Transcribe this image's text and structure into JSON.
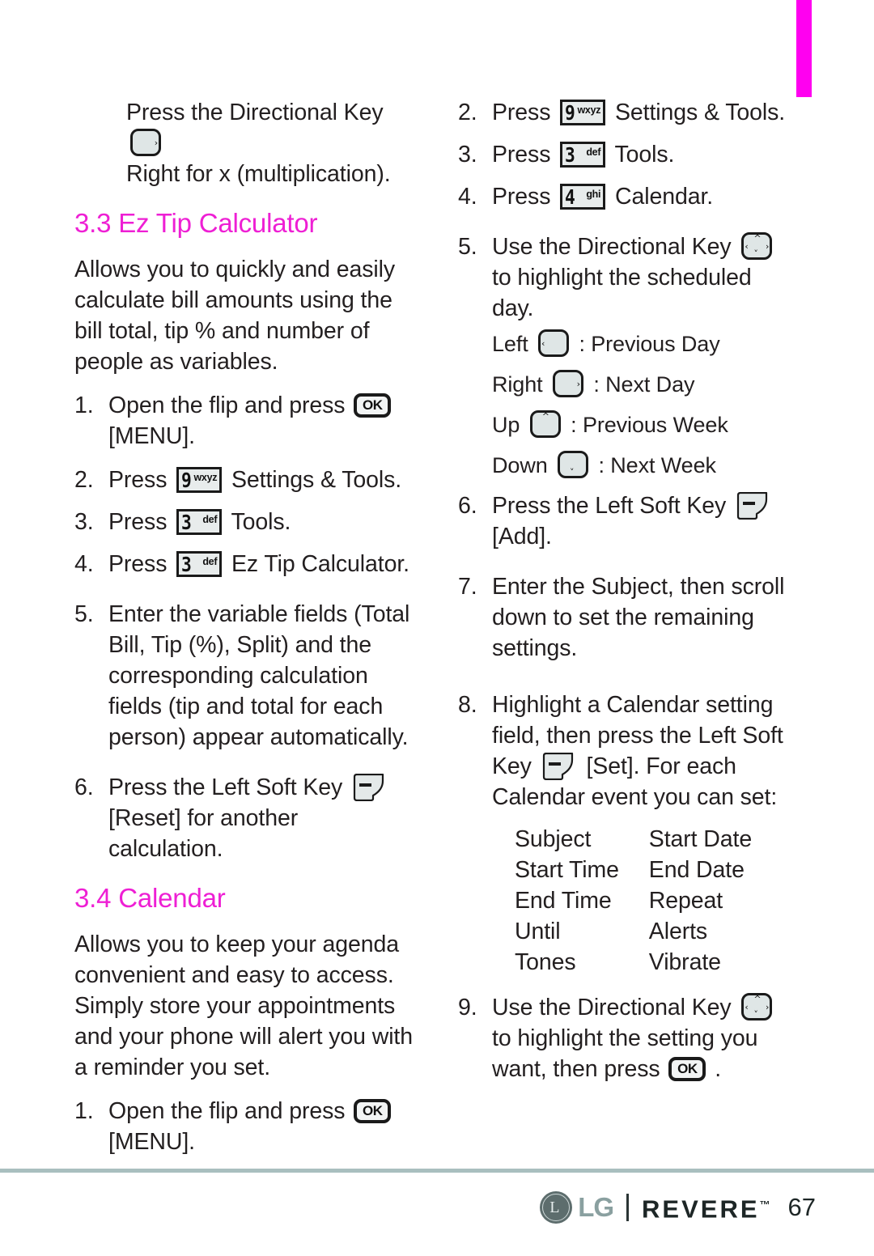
{
  "page": {
    "number": "67",
    "tab_color": "#ff00f0",
    "heading_color": "#ee1fd4",
    "rule_color": "#a9bfbf"
  },
  "footer": {
    "lg_text": "LG",
    "product_text": "REVERE",
    "trademark": "™",
    "page_number": "67"
  },
  "left_column": {
    "continued_note": {
      "line1_pre": "Press the Directional Key",
      "line1_key": "directional-key-right",
      "line2": "Right for x (multiplication)."
    },
    "section_ez_tip": {
      "heading": "3.3 Ez Tip Calculator",
      "intro": "Allows you to quickly and easily calculate bill amounts using the bill total, tip % and number of people as variables.",
      "steps": [
        {
          "num": "1.",
          "pre": "Open the flip and press",
          "key": "ok-key",
          "post": "[MENU]."
        },
        {
          "num": "2.",
          "pre": "Press",
          "key": {
            "digit": "9",
            "letters": "wxyz"
          },
          "post": "Settings & Tools."
        },
        {
          "num": "3.",
          "pre": "Press",
          "key": {
            "digit": "3",
            "letters": "def"
          },
          "post": "Tools."
        },
        {
          "num": "4.",
          "pre": "Press",
          "key": {
            "digit": "3",
            "letters": "def"
          },
          "post": "Ez Tip Calculator."
        },
        {
          "num": "5.",
          "pre": "Enter the variable fields (Total Bill, Tip (%), Split) and the corresponding calculation fields (tip and total for each person) appear automatically.",
          "key": null,
          "post": ""
        },
        {
          "num": "6.",
          "pre": "Press the Left Soft Key",
          "key": "left-soft-key",
          "post": "[Reset] for another calculation."
        }
      ]
    },
    "section_calendar": {
      "heading": "3.4 Calendar",
      "intro": "Allows you to keep your agenda convenient and easy to access. Simply store your appointments and your phone will alert you with a reminder you set.",
      "steps": [
        {
          "num": "1.",
          "pre": "Open the flip and press",
          "key": "ok-key",
          "post": "[MENU]."
        }
      ]
    }
  },
  "right_column": {
    "steps": [
      {
        "num": "2.",
        "pre": "Press",
        "key": {
          "digit": "9",
          "letters": "wxyz"
        },
        "post": "Settings & Tools."
      },
      {
        "num": "3.",
        "pre": "Press",
        "key": {
          "digit": "3",
          "letters": "def"
        },
        "post": "Tools."
      },
      {
        "num": "4.",
        "pre": "Press",
        "key": {
          "digit": "4",
          "letters": "ghi"
        },
        "post": "Calendar."
      },
      {
        "num": "5.",
        "pre": "Use the Directional Key",
        "key": "directional-key-all",
        "post": "to highlight  the scheduled day."
      },
      {
        "num": "6.",
        "pre": "Press the Left Soft Key",
        "key": "left-soft-key",
        "post": "[Add]."
      },
      {
        "num": "7.",
        "pre": "Enter the Subject, then scroll down to set the remaining settings.",
        "key": null,
        "post": ""
      },
      {
        "num": "8.",
        "pre": "Highlight a Calendar setting field, then press the Left Soft Key",
        "key": "left-soft-key",
        "post": "[Set]. For each Calendar event you can set:"
      },
      {
        "num": "9.",
        "pre": "Use the Directional Key",
        "key": "directional-key-all",
        "post": "to highlight the setting you want, then press",
        "key2": "ok-key",
        "post2": "."
      }
    ],
    "direction_list": [
      {
        "label": "Left",
        "key": "directional-key-left",
        "desc": ": Previous Day"
      },
      {
        "label": "Right",
        "key": "directional-key-right",
        "desc": ": Next Day"
      },
      {
        "label": "Up",
        "key": "directional-key-up",
        "desc": ": Previous Week"
      },
      {
        "label": "Down",
        "key": "directional-key-down",
        "desc": ": Next Week"
      }
    ],
    "settings_table": {
      "rows": [
        {
          "c1": "Subject",
          "c2": "Start Date"
        },
        {
          "c1": "Start Time",
          "c2": "End Date"
        },
        {
          "c1": "End Time",
          "c2": "Repeat"
        },
        {
          "c1": "Until",
          "c2": "Alerts"
        },
        {
          "c1": "Tones",
          "c2": "Vibrate"
        }
      ]
    }
  }
}
